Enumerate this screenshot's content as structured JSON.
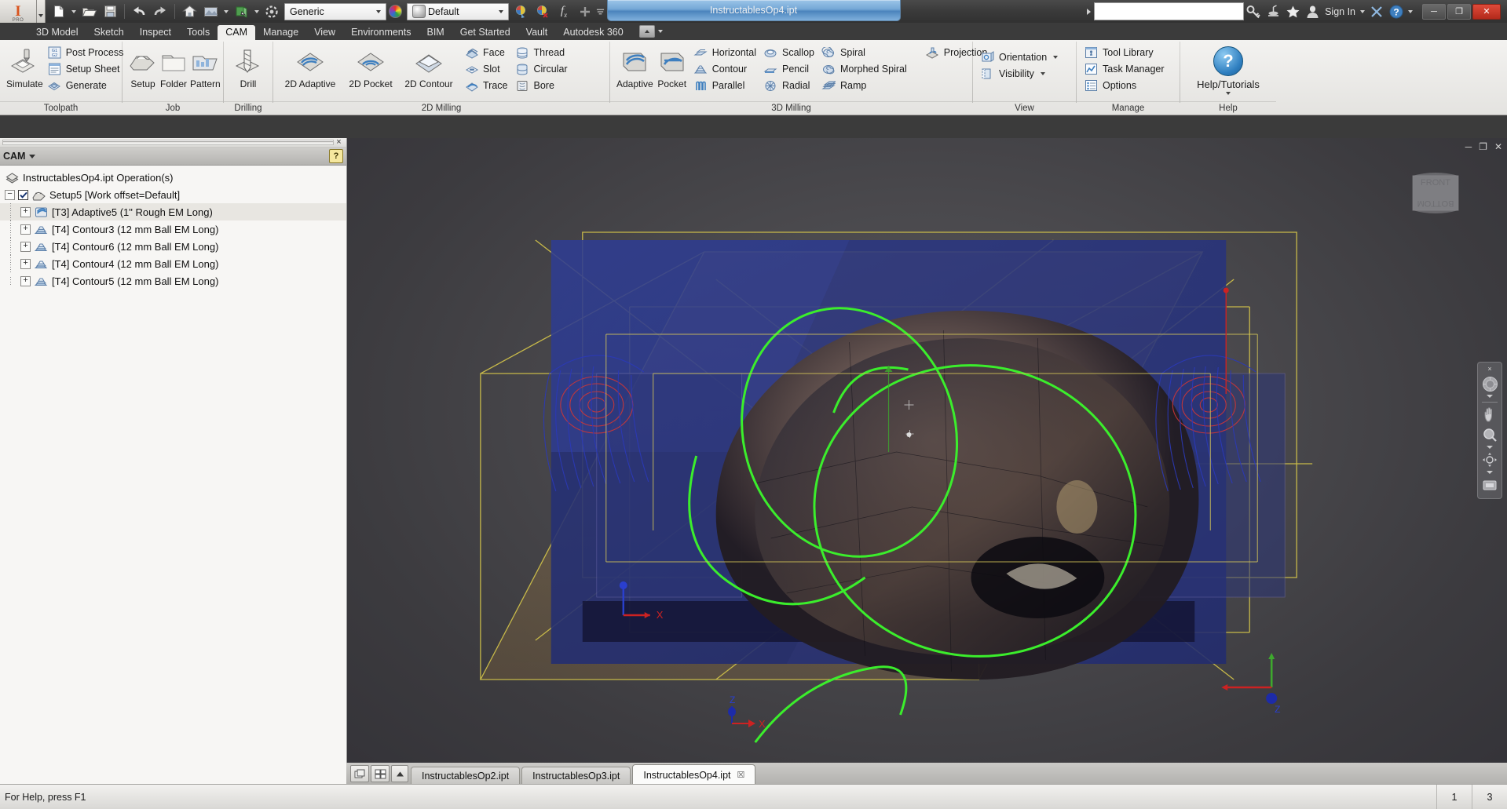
{
  "titlebar": {
    "app_short": "I",
    "app_edition": "PRO",
    "document_title": "InstructablesOp4.ipt",
    "material_combo": {
      "value": "Generic"
    },
    "appearance_combo": {
      "value": "Default"
    },
    "search": {
      "value": "",
      "placeholder": ""
    },
    "sign_in_label": "Sign In",
    "quick_access": [
      {
        "name": "new-icon",
        "label": "New"
      },
      {
        "name": "open-icon",
        "label": "Open"
      },
      {
        "name": "save-icon",
        "label": "Save"
      },
      {
        "name": "undo-icon",
        "label": "Undo"
      },
      {
        "name": "redo-icon",
        "label": "Redo"
      },
      {
        "name": "home-icon",
        "label": "Home"
      },
      {
        "name": "appearance-icon",
        "label": "Appearance"
      },
      {
        "name": "material-icon",
        "label": "Material"
      },
      {
        "name": "update-icon",
        "label": "Update"
      }
    ],
    "right_icons": [
      {
        "name": "key-icon",
        "label": "Sign In Options"
      },
      {
        "name": "satellite-icon",
        "label": "Autodesk A360"
      },
      {
        "name": "star-icon",
        "label": "Favorites"
      },
      {
        "name": "user-icon",
        "label": "Account"
      }
    ],
    "window_buttons": {
      "minimize": "─",
      "restore": "❐",
      "close": "✕"
    }
  },
  "ribbon": {
    "tabs": [
      {
        "label": "3D Model",
        "active": false
      },
      {
        "label": "Sketch",
        "active": false
      },
      {
        "label": "Inspect",
        "active": false
      },
      {
        "label": "Tools",
        "active": false
      },
      {
        "label": "CAM",
        "active": true
      },
      {
        "label": "Manage",
        "active": false
      },
      {
        "label": "View",
        "active": false
      },
      {
        "label": "Environments",
        "active": false
      },
      {
        "label": "BIM",
        "active": false
      },
      {
        "label": "Get Started",
        "active": false
      },
      {
        "label": "Vault",
        "active": false
      },
      {
        "label": "Autodesk 360",
        "active": false
      }
    ],
    "panels": [
      {
        "title": "Toolpath",
        "big_buttons": [
          {
            "label": "Simulate",
            "icon": "simulate-icon"
          }
        ],
        "small_buttons": [
          {
            "label": "Post Process",
            "icon": "post-process-icon"
          },
          {
            "label": "Setup Sheet",
            "icon": "setup-sheet-icon"
          },
          {
            "label": "Generate",
            "icon": "generate-icon"
          }
        ]
      },
      {
        "title": "Job",
        "big_buttons": [
          {
            "label": "Setup",
            "icon": "setup-icon"
          },
          {
            "label": "Folder",
            "icon": "folder-icon"
          },
          {
            "label": "Pattern",
            "icon": "pattern-icon"
          }
        ],
        "small_buttons": []
      },
      {
        "title": "Drilling",
        "big_buttons": [
          {
            "label": "Drill",
            "icon": "drill-icon"
          }
        ],
        "small_buttons": []
      },
      {
        "title": "2D Milling",
        "big_buttons": [
          {
            "label": "2D Adaptive",
            "icon": "adaptive-2d-icon"
          },
          {
            "label": "2D Pocket",
            "icon": "pocket-2d-icon"
          },
          {
            "label": "2D Contour",
            "icon": "contour-2d-icon"
          }
        ],
        "small_buttons": [
          {
            "label": "Face",
            "icon": "face-icon"
          },
          {
            "label": "Slot",
            "icon": "slot-icon"
          },
          {
            "label": "Trace",
            "icon": "trace-icon"
          },
          {
            "label": "Thread",
            "icon": "thread-icon"
          },
          {
            "label": "Circular",
            "icon": "circular-icon"
          },
          {
            "label": "Bore",
            "icon": "bore-icon"
          }
        ]
      },
      {
        "title": "3D Milling",
        "big_buttons": [
          {
            "label": "Adaptive",
            "icon": "adaptive-3d-icon"
          },
          {
            "label": "Pocket",
            "icon": "pocket-3d-icon"
          }
        ],
        "small_buttons": [
          {
            "label": "Horizontal",
            "icon": "horizontal-icon"
          },
          {
            "label": "Contour",
            "icon": "contour-icon"
          },
          {
            "label": "Parallel",
            "icon": "parallel-icon"
          },
          {
            "label": "Scallop",
            "icon": "scallop-icon"
          },
          {
            "label": "Pencil",
            "icon": "pencil-icon"
          },
          {
            "label": "Radial",
            "icon": "radial-icon"
          },
          {
            "label": "Spiral",
            "icon": "spiral-icon"
          },
          {
            "label": "Morphed Spiral",
            "icon": "morphed-spiral-icon"
          },
          {
            "label": "Ramp",
            "icon": "ramp-icon"
          },
          {
            "label": "Projection",
            "icon": "projection-icon"
          }
        ]
      },
      {
        "title": "View",
        "big_buttons": [],
        "small_buttons": [
          {
            "label": "Orientation",
            "icon": "orientation-icon",
            "dropdown": true
          },
          {
            "label": "Visibility",
            "icon": "visibility-icon",
            "dropdown": true
          }
        ]
      },
      {
        "title": "Manage",
        "big_buttons": [],
        "small_buttons": [
          {
            "label": "Tool Library",
            "icon": "tool-library-icon"
          },
          {
            "label": "Task Manager",
            "icon": "task-manager-icon"
          },
          {
            "label": "Options",
            "icon": "options-icon"
          }
        ]
      },
      {
        "title": "Help",
        "big_buttons": [
          {
            "label": "Help/Tutorials",
            "icon": "help-icon",
            "dropdown": true
          }
        ],
        "small_buttons": []
      }
    ]
  },
  "browser": {
    "pane_title": "CAM",
    "help_badge": "?",
    "close_label": "×",
    "tree": [
      {
        "label": "InstructablesOp4.ipt Operation(s)",
        "level": 0,
        "icon": "document-icon",
        "expander": "",
        "checkbox": false,
        "selected": false
      },
      {
        "label": "Setup5 [Work offset=Default]",
        "level": 1,
        "icon": "setup-icon",
        "expander": "−",
        "checkbox": true,
        "selected": false
      },
      {
        "label": "[T3] Adaptive5 (1\" Rough EM Long)",
        "level": 2,
        "icon": "adaptive-op-icon",
        "expander": "+",
        "checkbox": false,
        "selected": true
      },
      {
        "label": "[T4] Contour3 (12 mm Ball EM Long)",
        "level": 2,
        "icon": "contour-op-icon",
        "expander": "+",
        "checkbox": false,
        "selected": false
      },
      {
        "label": "[T4] Contour6 (12 mm Ball EM Long)",
        "level": 2,
        "icon": "contour-op-icon",
        "expander": "+",
        "checkbox": false,
        "selected": false
      },
      {
        "label": "[T4] Contour4 (12 mm Ball EM Long)",
        "level": 2,
        "icon": "contour-op-icon",
        "expander": "+",
        "checkbox": false,
        "selected": false
      },
      {
        "label": "[T4] Contour5 (12 mm Ball EM Long)",
        "level": 2,
        "icon": "contour-op-icon",
        "expander": "+",
        "checkbox": false,
        "selected": false
      }
    ]
  },
  "viewport": {
    "viewcube": {
      "front_face": "FRONT",
      "bottom_face": "BOTTOM"
    },
    "triad": {
      "z_label": "Z",
      "x_label": "X"
    },
    "origin_triad": {
      "x_label": "X"
    },
    "nav_bar": {
      "close": "×",
      "items": [
        {
          "name": "steering-wheel-icon"
        },
        {
          "name": "pan-icon"
        },
        {
          "name": "zoom-icon"
        },
        {
          "name": "orbit-icon"
        },
        {
          "name": "look-at-icon"
        }
      ]
    },
    "window_buttons": {
      "minimize": "─",
      "restore": "❐",
      "close": "✕"
    }
  },
  "doc_tabs": {
    "tabs": [
      {
        "label": "InstructablesOp2.ipt",
        "active": false,
        "closable": false
      },
      {
        "label": "InstructablesOp3.ipt",
        "active": false,
        "closable": false
      },
      {
        "label": "InstructablesOp4.ipt",
        "active": true,
        "closable": true,
        "close_glyph": "☒"
      }
    ],
    "view_icons": [
      {
        "name": "cascade-windows-icon"
      },
      {
        "name": "tile-windows-icon"
      },
      {
        "name": "scroll-tabs-up-icon"
      }
    ]
  },
  "statusbar": {
    "message": "For Help, press F1",
    "cells": [
      "1",
      "3"
    ]
  },
  "colors": {
    "title_gradient_start": "#9cc5e8",
    "title_gradient_end": "#4b84bd",
    "ribbon_bg": "#f3f2f0",
    "chrome_dark": "#3b3b3b",
    "toolpath_green": "#4aee3a",
    "stock_yellow": "#d8c84a",
    "model_blue": "#2b3a8c",
    "accent_red": "#cc2222"
  }
}
